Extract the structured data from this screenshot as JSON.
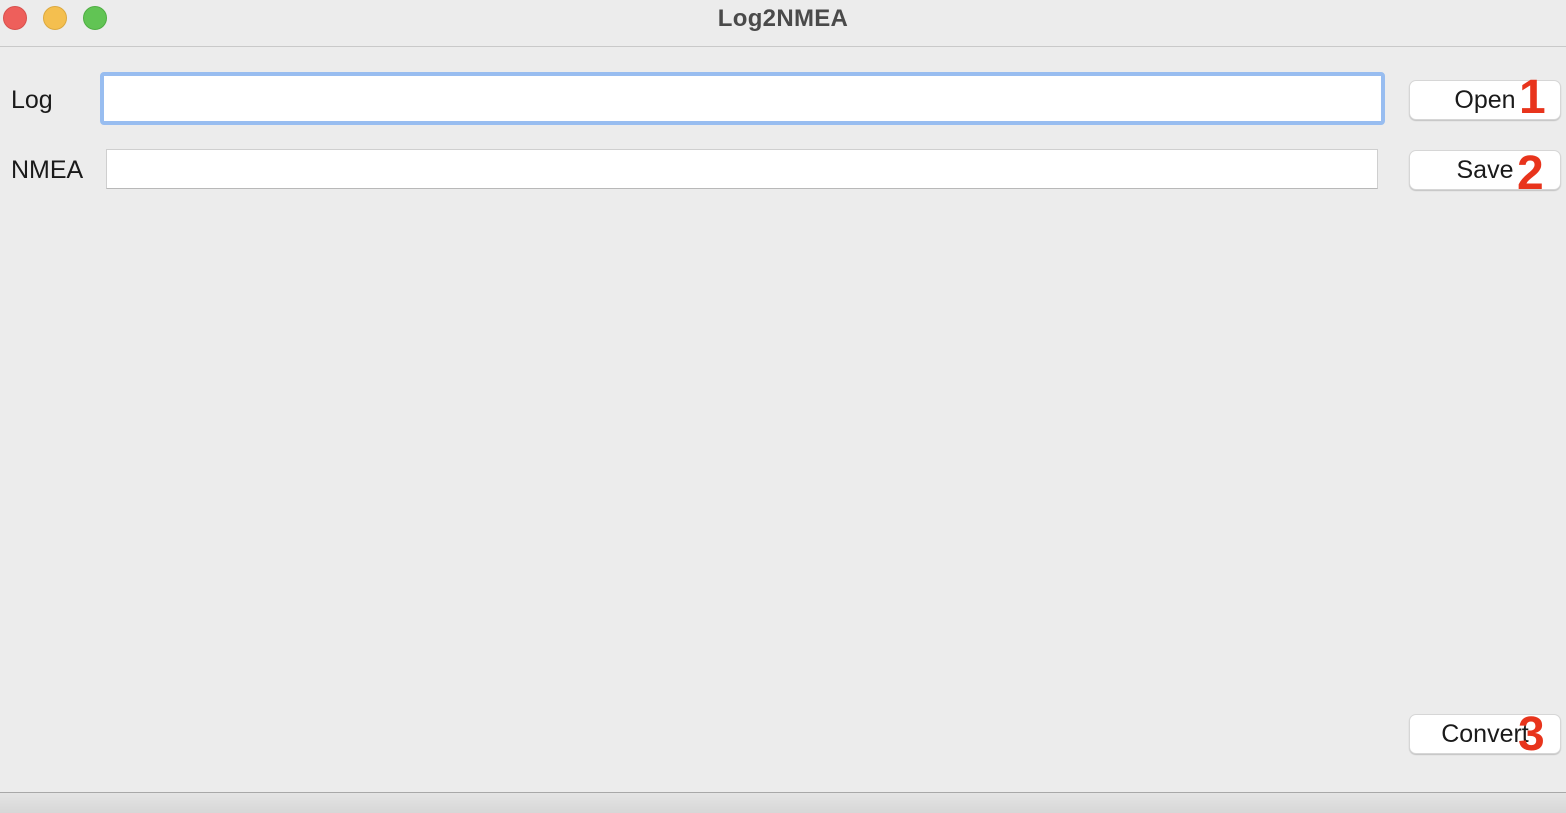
{
  "window": {
    "title": "Log2NMEA"
  },
  "form": {
    "log_label": "Log",
    "log_value": "",
    "nmea_label": "NMEA",
    "nmea_value": ""
  },
  "buttons": {
    "open_label": "Open",
    "save_label": "Save",
    "convert_label": "Convert"
  },
  "annotations": {
    "open_step": "1",
    "save_step": "2",
    "convert_step": "3",
    "color": "#e8341c"
  },
  "colors": {
    "focus_ring": "#98bdf0",
    "window_bg": "#ececec"
  }
}
